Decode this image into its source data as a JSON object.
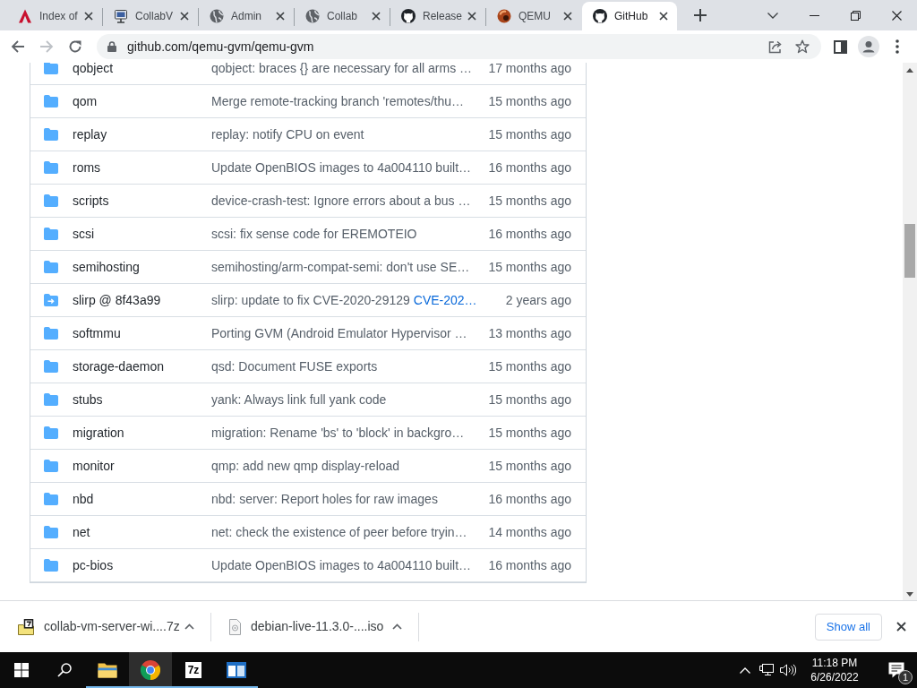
{
  "browser": {
    "tabs": [
      {
        "kind": "a-logo",
        "title": "Index of",
        "selected": false
      },
      {
        "kind": "computer",
        "title": "CollabV",
        "selected": false
      },
      {
        "kind": "globe",
        "title": "Admin",
        "selected": false
      },
      {
        "kind": "globe",
        "title": "Collab",
        "selected": false
      },
      {
        "kind": "cat",
        "title": "Release",
        "selected": false
      },
      {
        "kind": "orb",
        "title": "QEMU",
        "selected": false
      },
      {
        "kind": "cat",
        "title": "GitHub",
        "selected": true
      }
    ]
  },
  "toolbar": {
    "nav_buttons": [
      {
        "kind": "back",
        "disabled": false
      },
      {
        "kind": "forward",
        "disabled": true
      },
      {
        "kind": "reload",
        "disabled": false
      }
    ],
    "url": "github.com/qemu-gvm/qemu-gvm"
  },
  "file_list": {
    "rows": [
      {
        "kind": "folder",
        "name": "qobject",
        "message": "qobject: braces {} are necessary for all arms …",
        "age": "17 months ago"
      },
      {
        "kind": "folder",
        "name": "qom",
        "message": "Merge remote-tracking branch 'remotes/thu…",
        "age": "15 months ago"
      },
      {
        "kind": "folder",
        "name": "replay",
        "message": "replay: notify CPU on event",
        "age": "15 months ago"
      },
      {
        "kind": "folder",
        "name": "roms",
        "message": "Update OpenBIOS images to 4a004110 built…",
        "age": "16 months ago"
      },
      {
        "kind": "folder",
        "name": "scripts",
        "message": "device-crash-test: Ignore errors about a bus …",
        "age": "15 months ago"
      },
      {
        "kind": "folder",
        "name": "scsi",
        "message": "scsi: fix sense code for EREMOTEIO",
        "age": "16 months ago"
      },
      {
        "kind": "folder",
        "name": "semihosting",
        "message": "semihosting/arm-compat-semi: don't use SE…",
        "age": "15 months ago"
      },
      {
        "kind": "submodule",
        "name": "slirp @ 8f43a99",
        "message": "slirp: update to fix CVE-2020-29129",
        "message_link": "CVE-202…",
        "age": "2 years ago"
      },
      {
        "kind": "folder",
        "name": "softmmu",
        "message": "Porting GVM (Android Emulator Hypervisor …",
        "age": "13 months ago"
      },
      {
        "kind": "folder",
        "name": "storage-daemon",
        "message": "qsd: Document FUSE exports",
        "age": "15 months ago"
      },
      {
        "kind": "folder",
        "name": "stubs",
        "message": "yank: Always link full yank code",
        "age": "15 months ago"
      },
      {
        "kind": "folder",
        "name": "migration",
        "message": "migration: Rename 'bs' to 'block' in backgro…",
        "age": "15 months ago"
      },
      {
        "kind": "folder",
        "name": "monitor",
        "message": "qmp: add new qmp display-reload",
        "age": "15 months ago"
      },
      {
        "kind": "folder",
        "name": "nbd",
        "message": "nbd: server: Report holes for raw images",
        "age": "16 months ago"
      },
      {
        "kind": "folder",
        "name": "net",
        "message": "net: check the existence of peer before tryin…",
        "age": "14 months ago"
      },
      {
        "kind": "folder",
        "name": "pc-bios",
        "message": "Update OpenBIOS images to 4a004110 built…",
        "age": "16 months ago"
      }
    ]
  },
  "download_bar": {
    "items": [
      {
        "kind": "archive",
        "filename": "collab-vm-server-wi....7z"
      },
      {
        "kind": "disc-image",
        "filename": "debian-live-11.3.0-....iso"
      }
    ],
    "show_all": "Show all"
  },
  "taskbar": {
    "apps": [
      {
        "kind": "folder",
        "running": true,
        "selected": false
      },
      {
        "kind": "browser",
        "running": true,
        "selected": true
      },
      {
        "kind": "archiver",
        "label": "7z",
        "running": true,
        "selected": false
      },
      {
        "kind": "window",
        "running": true,
        "selected": false
      }
    ],
    "clock": {
      "time": "11:18 PM",
      "date": "6/26/2022"
    },
    "notification_count": "1"
  }
}
